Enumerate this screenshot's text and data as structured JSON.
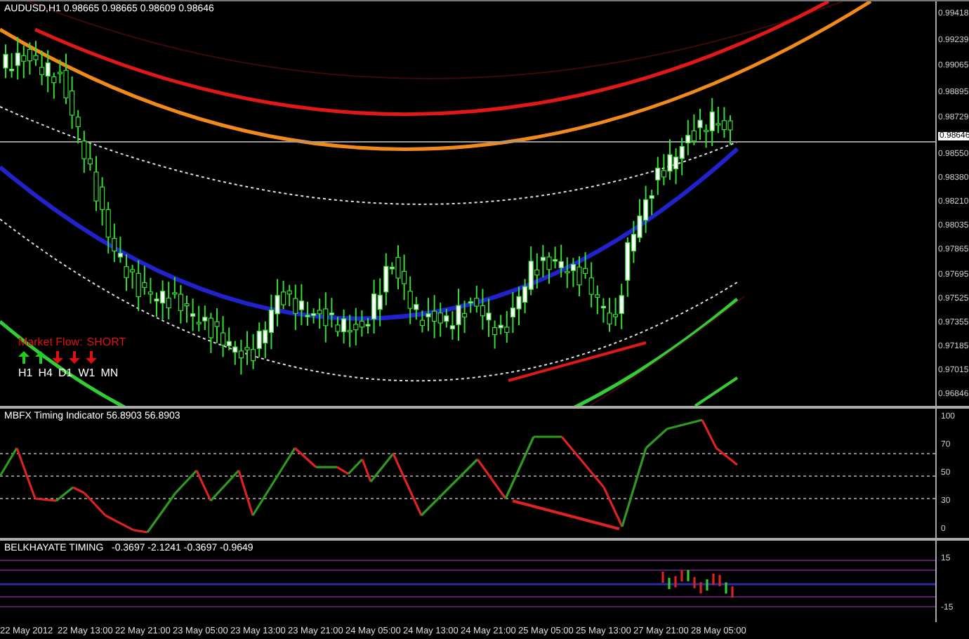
{
  "chart": {
    "symbol": "AUDUSD,H1",
    "quote": [
      "0.98665",
      "0.98665",
      "0.98609",
      "0.98646"
    ]
  },
  "price_axis": [
    {
      "label": "0.99418",
      "kind": "tick"
    },
    {
      "label": "0.99239",
      "kind": "tick"
    },
    {
      "label": "0.99065",
      "kind": "tick"
    },
    {
      "label": "0.98895",
      "kind": "tick"
    },
    {
      "label": "0.98729",
      "kind": "tick"
    },
    {
      "label": "0.98646",
      "kind": "current"
    },
    {
      "label": "0.98550",
      "kind": "tick"
    },
    {
      "label": "0.98380",
      "kind": "tick"
    },
    {
      "label": "0.98210",
      "kind": "tick"
    },
    {
      "label": "0.98035",
      "kind": "tick"
    },
    {
      "label": "0.97865",
      "kind": "tick"
    },
    {
      "label": "0.97695",
      "kind": "tick"
    },
    {
      "label": "0.97525",
      "kind": "tick"
    },
    {
      "label": "0.97355",
      "kind": "tick"
    },
    {
      "label": "0.97185",
      "kind": "tick"
    },
    {
      "label": "0.97015",
      "kind": "tick"
    },
    {
      "label": "0.96846",
      "kind": "tick"
    }
  ],
  "market_flow": {
    "label": "Market Flow:",
    "signal": "SHORT",
    "timeframes": [
      {
        "label": "H1",
        "kind": "up"
      },
      {
        "label": "H4",
        "kind": "up"
      },
      {
        "label": "D1",
        "kind": "down"
      },
      {
        "label": "W1",
        "kind": "down"
      },
      {
        "label": "MN",
        "kind": "down"
      }
    ]
  },
  "indicators": [
    {
      "name": "MBFX Timing Indicator",
      "values": [
        "56.8903",
        "56.8903"
      ],
      "axis": [
        "100",
        "70",
        "50",
        "30",
        "0"
      ]
    },
    {
      "name": "BELKHAYATE TIMING",
      "values": [
        "-0.3697",
        "-2.1241",
        "-0.3697",
        "-0.9649"
      ],
      "axis": [
        "15",
        "-15"
      ]
    }
  ],
  "time_axis": [
    "22 May 2012",
    "22 May 13:00",
    "22 May 21:00",
    "23 May 05:00",
    "23 May 13:00",
    "23 May 21:00",
    "24 May 05:00",
    "24 May 13:00",
    "24 May 21:00",
    "25 May 05:00",
    "25 May 13:00",
    "27 May 21:00",
    "28 May 05:00"
  ]
}
